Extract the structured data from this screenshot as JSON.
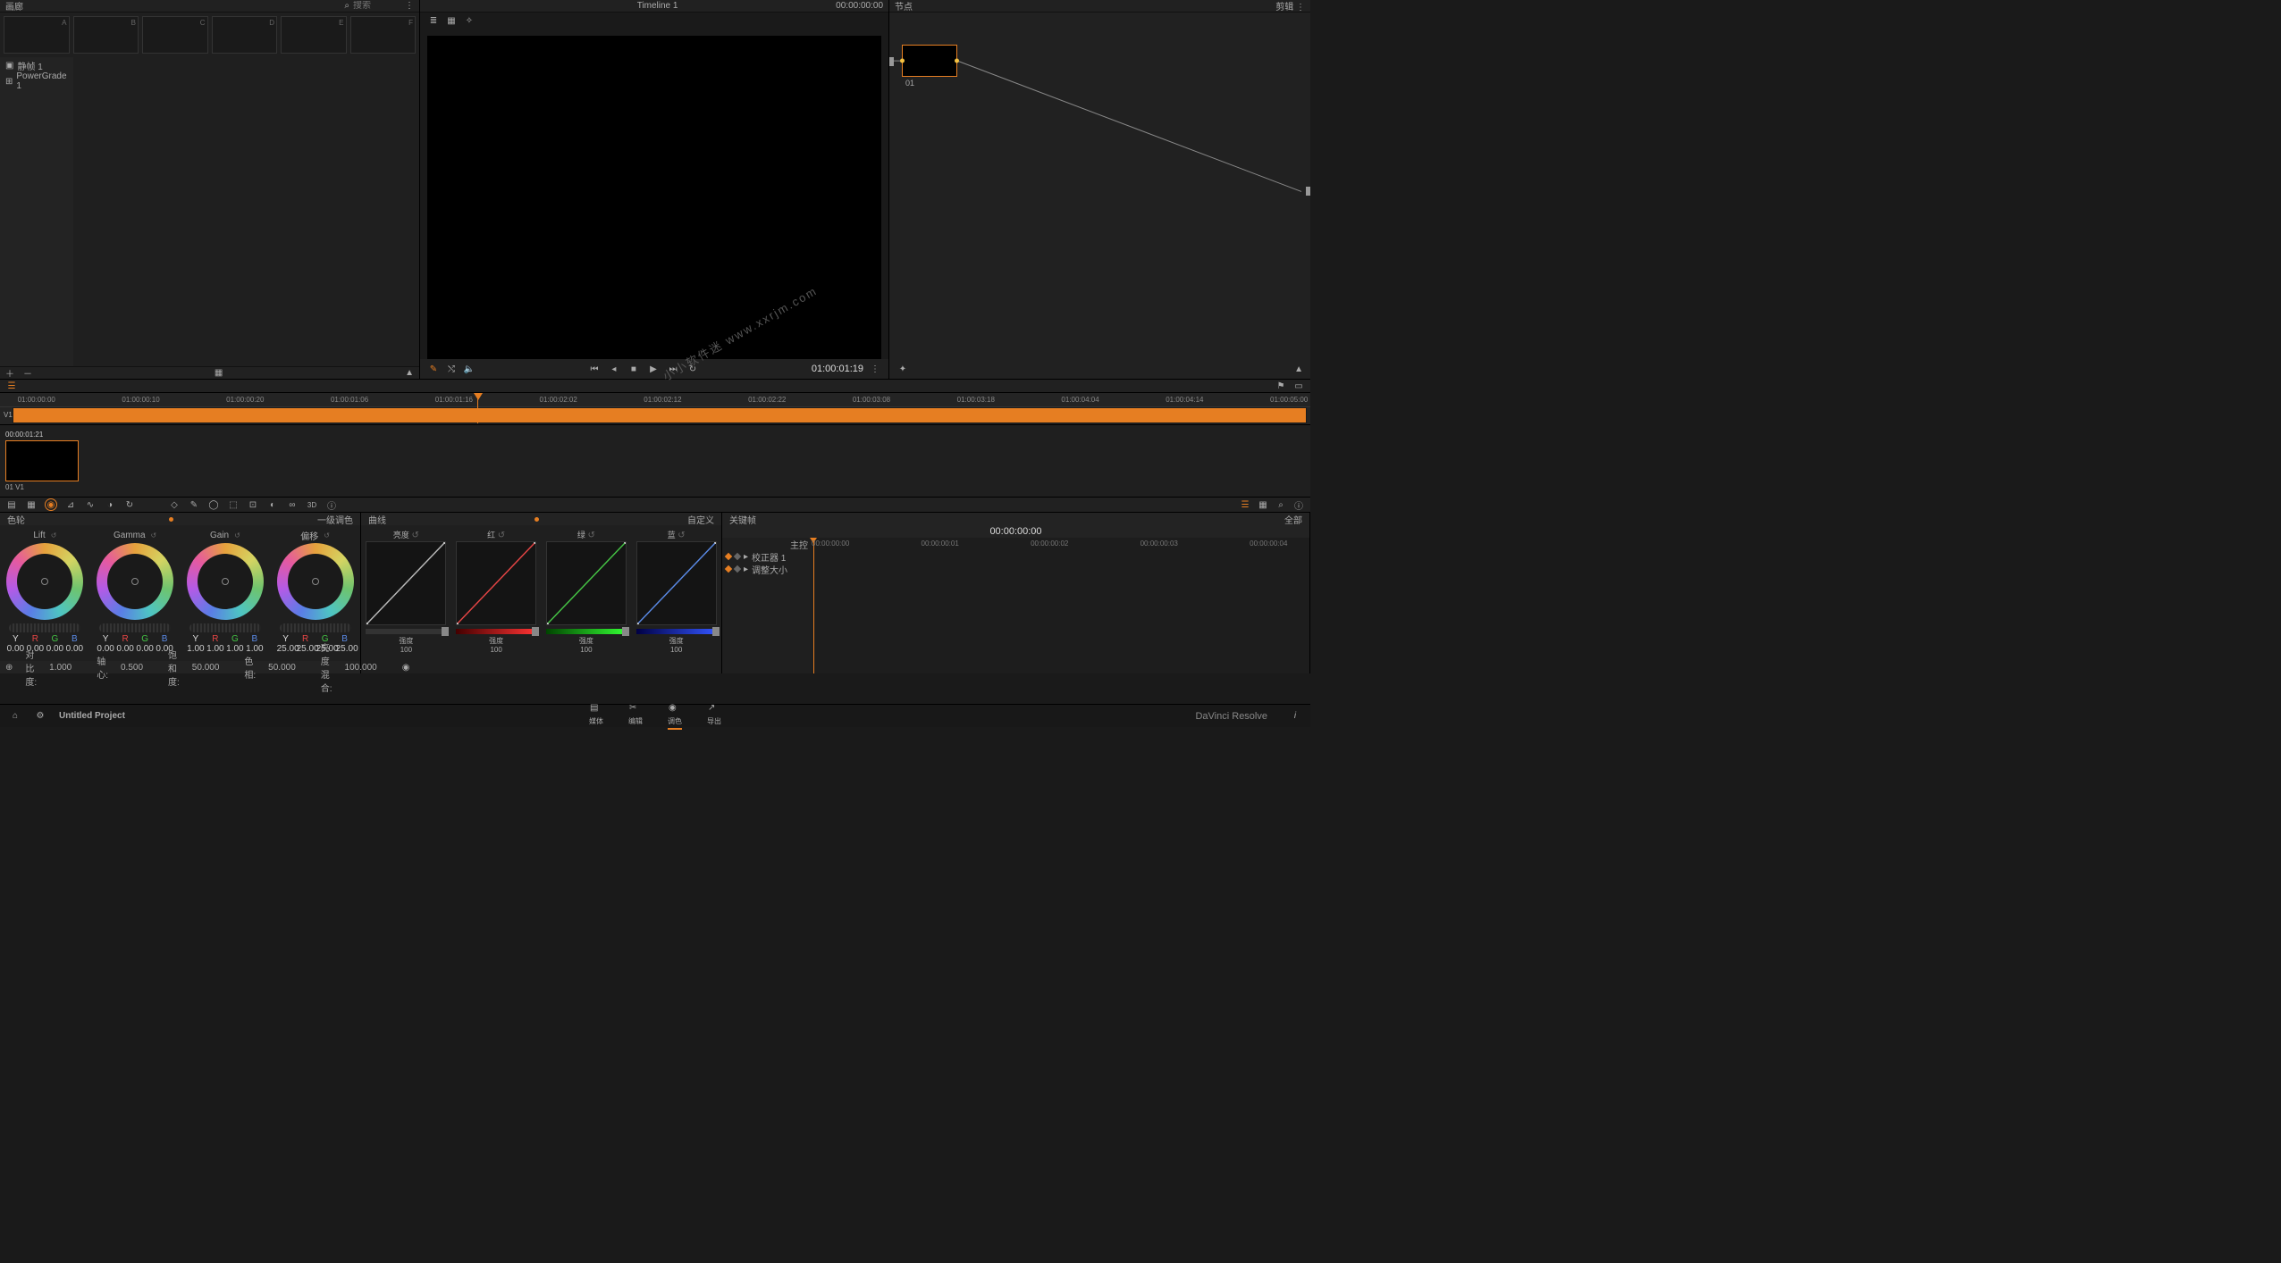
{
  "gallery": {
    "title": "画廊",
    "search_placeholder": "搜索",
    "slots": [
      "A",
      "B",
      "C",
      "D",
      "E",
      "F"
    ],
    "side_items": [
      {
        "label": "静帧 1",
        "active": true
      },
      {
        "label": "PowerGrade 1",
        "active": false
      }
    ]
  },
  "viewer": {
    "title": "Timeline 1",
    "header_tc": "00:00:00:00",
    "current_tc": "01:00:01:19",
    "watermark": "小小软件迷 www.xxrjm.com"
  },
  "nodes": {
    "title": "节点",
    "right_label": "剪辑",
    "node_label": "01"
  },
  "ruler": {
    "ticks": [
      "01:00:00:00",
      "01:00:00:10",
      "01:00:00:20",
      "01:00:01:06",
      "01:00:01:16",
      "01:00:02:02",
      "01:00:02:12",
      "01:00:02:22",
      "01:00:03:08",
      "01:00:03:18",
      "01:00:04:04",
      "01:00:04:14",
      "01:00:05:00"
    ],
    "track_label": "V1",
    "playhead_pct": 36.5
  },
  "clip": {
    "tc": "00:00:01:21",
    "meta": "01  V1"
  },
  "wheels": {
    "title_left": "色轮",
    "title_right": "一级调色",
    "cols": [
      {
        "name": "Lift",
        "y": "0.00",
        "r": "0.00",
        "g": "0.00",
        "b": "0.00"
      },
      {
        "name": "Gamma",
        "y": "0.00",
        "r": "0.00",
        "g": "0.00",
        "b": "0.00"
      },
      {
        "name": "Gain",
        "y": "1.00",
        "r": "1.00",
        "g": "1.00",
        "b": "1.00"
      },
      {
        "name": "偏移",
        "y": "25.00",
        "r": "25.00",
        "g": "25.00",
        "b": "25.00"
      }
    ],
    "footer": [
      {
        "k": "对比度:",
        "v": "1.000"
      },
      {
        "k": "轴心:",
        "v": "0.500"
      },
      {
        "k": "饱和度:",
        "v": "50.000"
      },
      {
        "k": "色相:",
        "v": "50.000"
      },
      {
        "k": "亮度混合:",
        "v": "100.000"
      }
    ]
  },
  "curves": {
    "title_left": "曲线",
    "title_right": "自定义",
    "cols": [
      {
        "name": "亮度",
        "slider": "gray",
        "label": "强度",
        "val": "100"
      },
      {
        "name": "红",
        "slider": "red",
        "label": "强度",
        "val": "100"
      },
      {
        "name": "绿",
        "slider": "green",
        "label": "强度",
        "val": "100"
      },
      {
        "name": "蓝",
        "slider": "blue",
        "label": "强度",
        "val": "100"
      }
    ]
  },
  "keyframes": {
    "title": "关键帧",
    "right": "全部",
    "tc": "00:00:00:00",
    "rows": [
      {
        "label": "主控"
      },
      {
        "label": "校正器 1"
      },
      {
        "label": "调整大小"
      }
    ],
    "ticks": [
      "00:00:00:00",
      "00:00:00:01",
      "00:00:00:02",
      "00:00:00:03",
      "00:00:00:04"
    ]
  },
  "footer": {
    "project": "Untitled Project",
    "tabs": [
      {
        "label": "媒体"
      },
      {
        "label": "编辑"
      },
      {
        "label": "调色",
        "active": true
      },
      {
        "label": "导出"
      }
    ],
    "brand": "DaVinci Resolve"
  }
}
